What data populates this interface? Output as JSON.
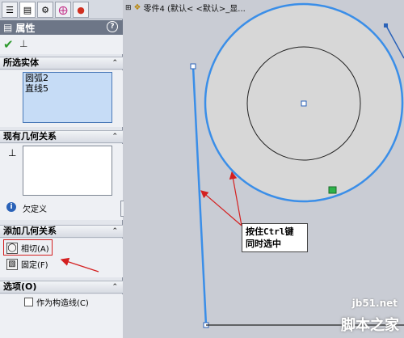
{
  "panel": {
    "tabs": [
      {
        "icon": "feature-manager-icon"
      },
      {
        "icon": "property-manager-icon"
      },
      {
        "icon": "config-manager-icon"
      },
      {
        "icon": "dimxpert-icon"
      },
      {
        "icon": "display-manager-icon"
      }
    ],
    "title": "属性",
    "confirm_icon": "checkmark-icon",
    "pin_icon": "pushpin-icon",
    "selected_entities": {
      "heading": "所选实体",
      "items": [
        "圆弧2",
        "直线5"
      ]
    },
    "existing_relations": {
      "heading": "现有几何关系",
      "status": "欠定义"
    },
    "add_relations": {
      "heading": "添加几何关系",
      "tangent_label": "相切(A)",
      "fix_label": "固定(F)"
    },
    "options": {
      "heading": "选项(O)",
      "construction_label": "作为构造线(C)"
    }
  },
  "canvas": {
    "breadcrumb": "零件4 (默认< <默认>_显...",
    "callout_line1": "按住Ctrl键",
    "callout_line2": "同时选中"
  },
  "watermark": {
    "url": "jb51.net",
    "name": "脚本之家"
  },
  "colors": {
    "sketch_blue": "#3a8ee8",
    "arrow_red": "#d42020",
    "circle_fill": "#d7d7d7"
  }
}
